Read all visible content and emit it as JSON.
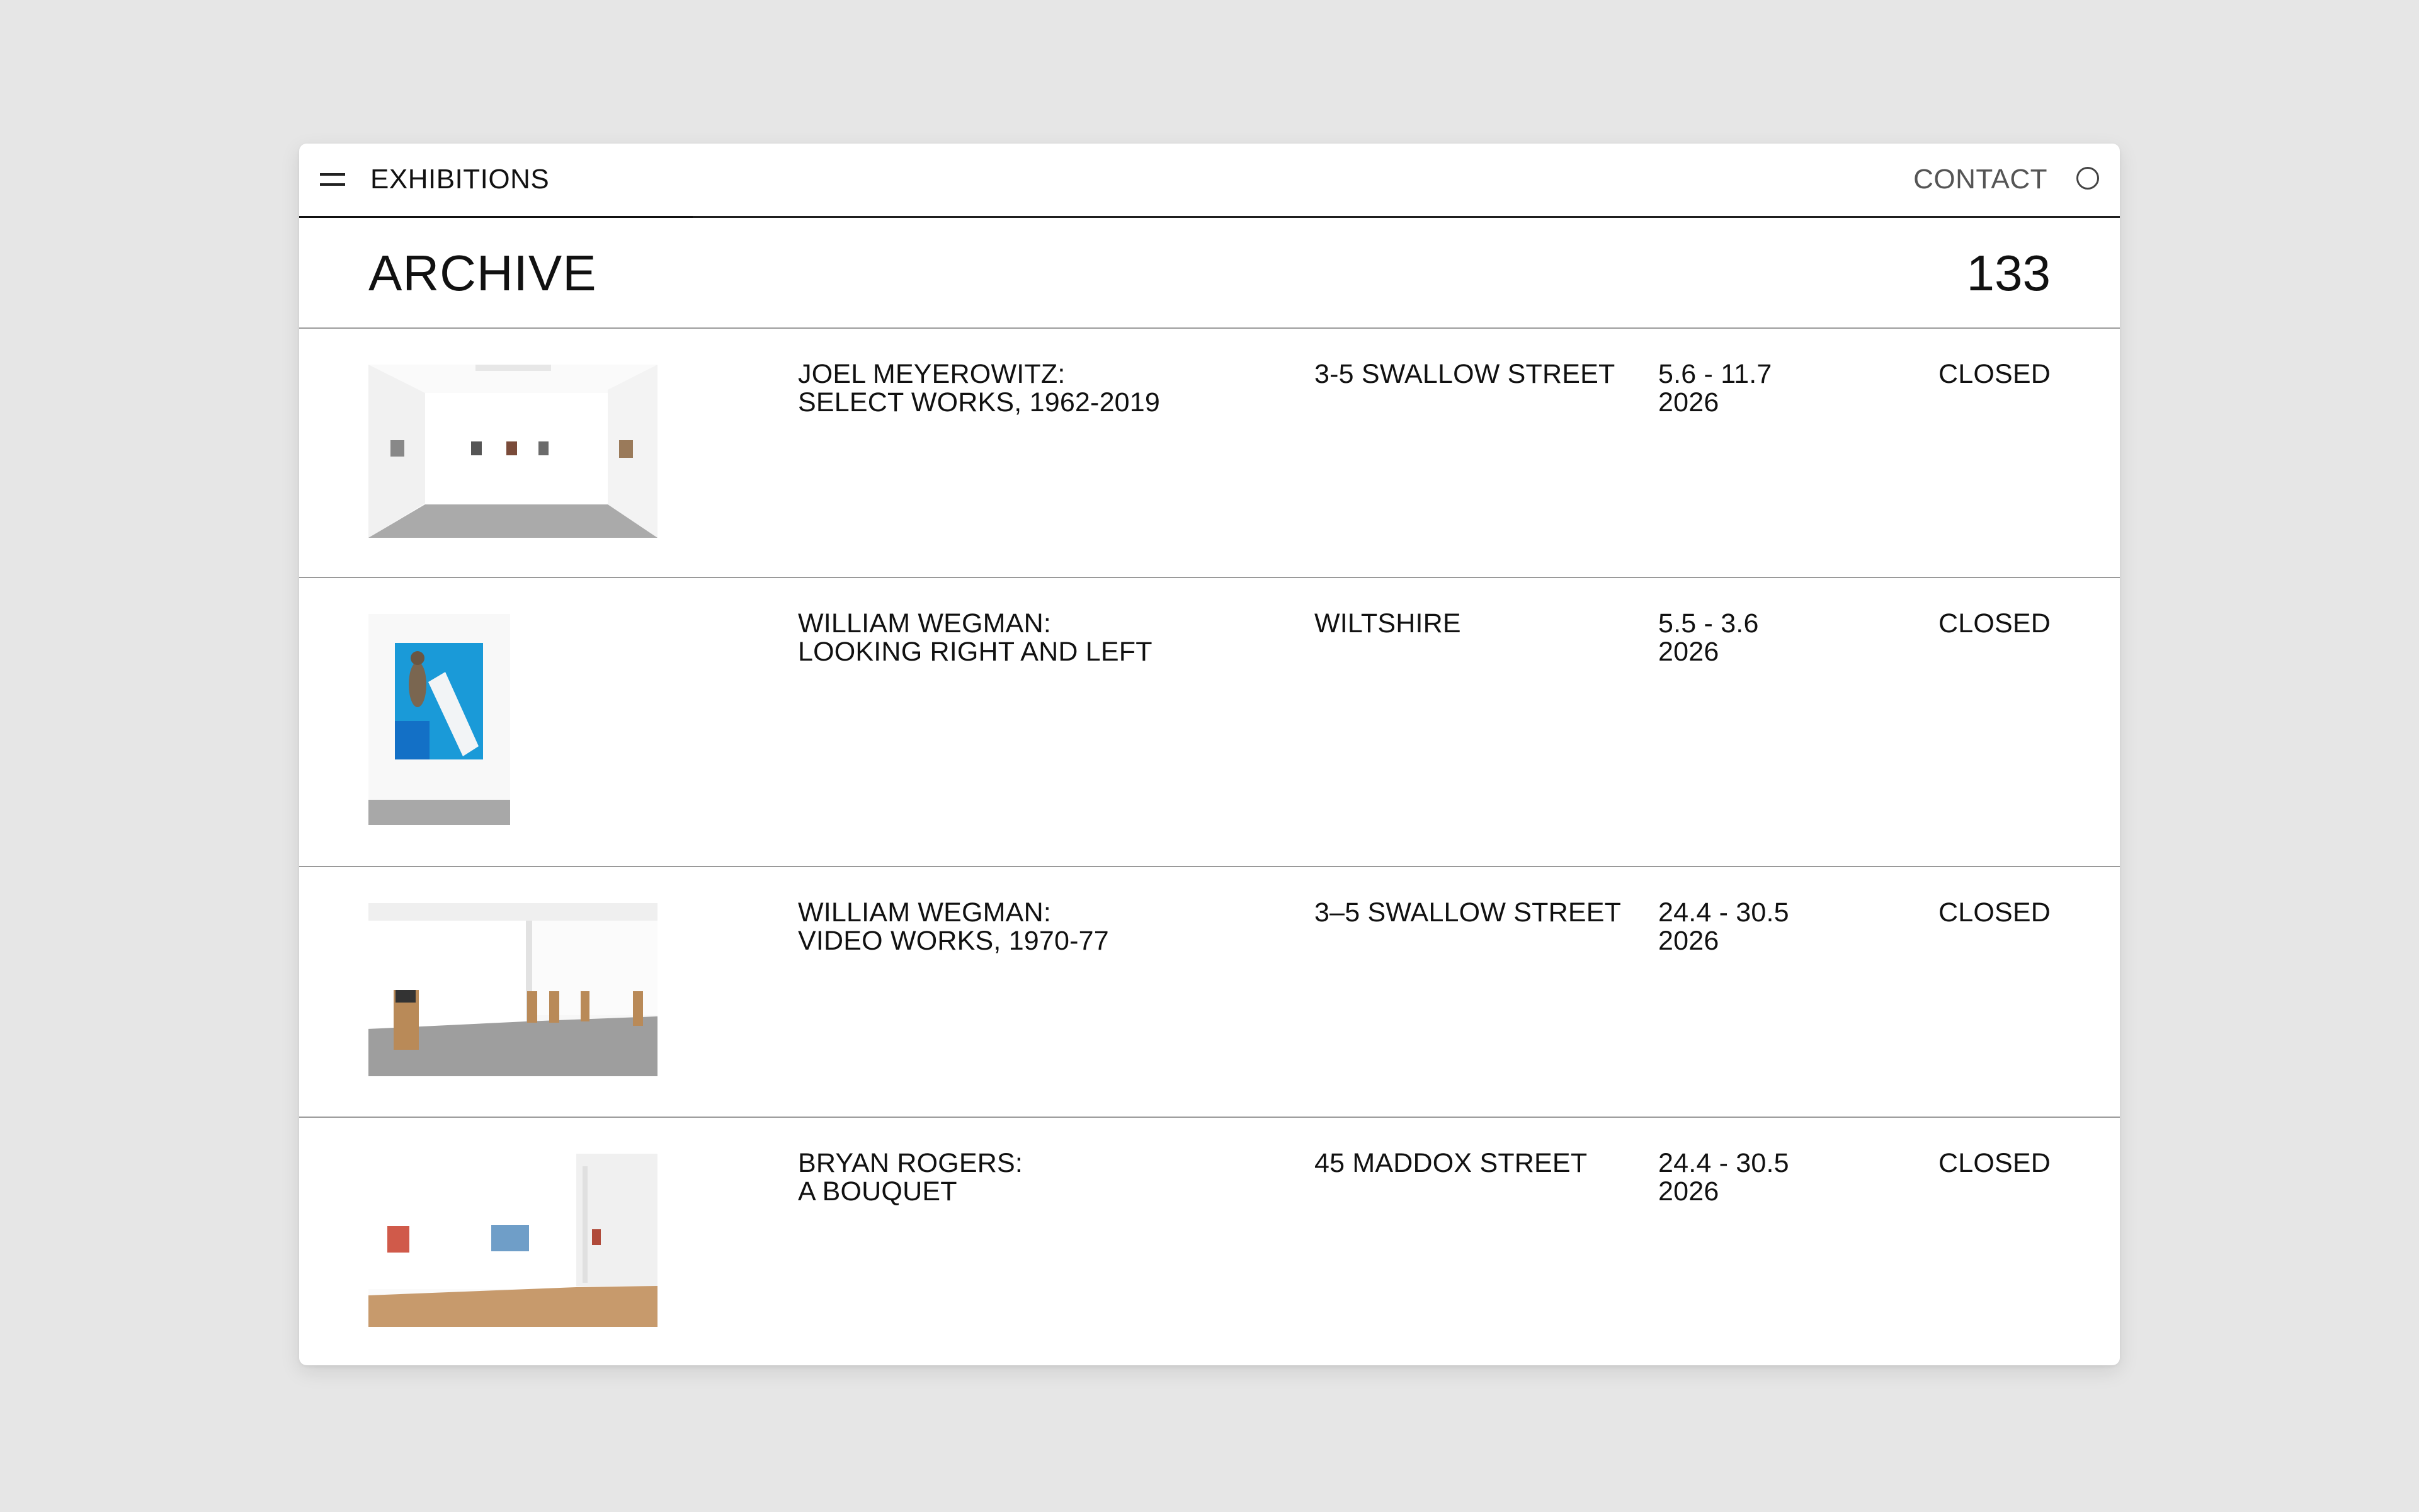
{
  "nav": {
    "title": "EXHIBITIONS",
    "contact": "CONTACT"
  },
  "archive": {
    "title": "ARCHIVE",
    "count": "133"
  },
  "exhibitions": [
    {
      "title_line1": "JOEL MEYEROWITZ:",
      "title_line2": "SELECT WORKS, 1962-2019",
      "location": "3-5 SWALLOW STREET",
      "dates": "5.6 - 11.7",
      "year": "2026",
      "status": "CLOSED"
    },
    {
      "title_line1": "WILLIAM WEGMAN:",
      "title_line2": "LOOKING RIGHT AND LEFT",
      "location": "WILTSHIRE",
      "dates": "5.5 - 3.6",
      "year": "2026",
      "status": "CLOSED"
    },
    {
      "title_line1": "WILLIAM WEGMAN:",
      "title_line2": "VIDEO WORKS, 1970-77",
      "location": "3–5 SWALLOW STREET",
      "dates": "24.4 - 30.5",
      "year": "2026",
      "status": "CLOSED"
    },
    {
      "title_line1": "BRYAN ROGERS:",
      "title_line2": "A BOUQUET",
      "location": "45 MADDOX STREET",
      "dates": "24.4 - 30.5",
      "year": "2026",
      "status": "CLOSED"
    }
  ],
  "colors": {
    "background": "#e6e6e6",
    "panel": "#ffffff",
    "text": "#111111",
    "divider": "#9a9a9a",
    "floor_concrete": "#a9a9a9",
    "floor_wood": "#c79a6c",
    "art_blue": "#1a9ad8"
  },
  "icons": [
    "menu-icon",
    "circle-icon"
  ]
}
